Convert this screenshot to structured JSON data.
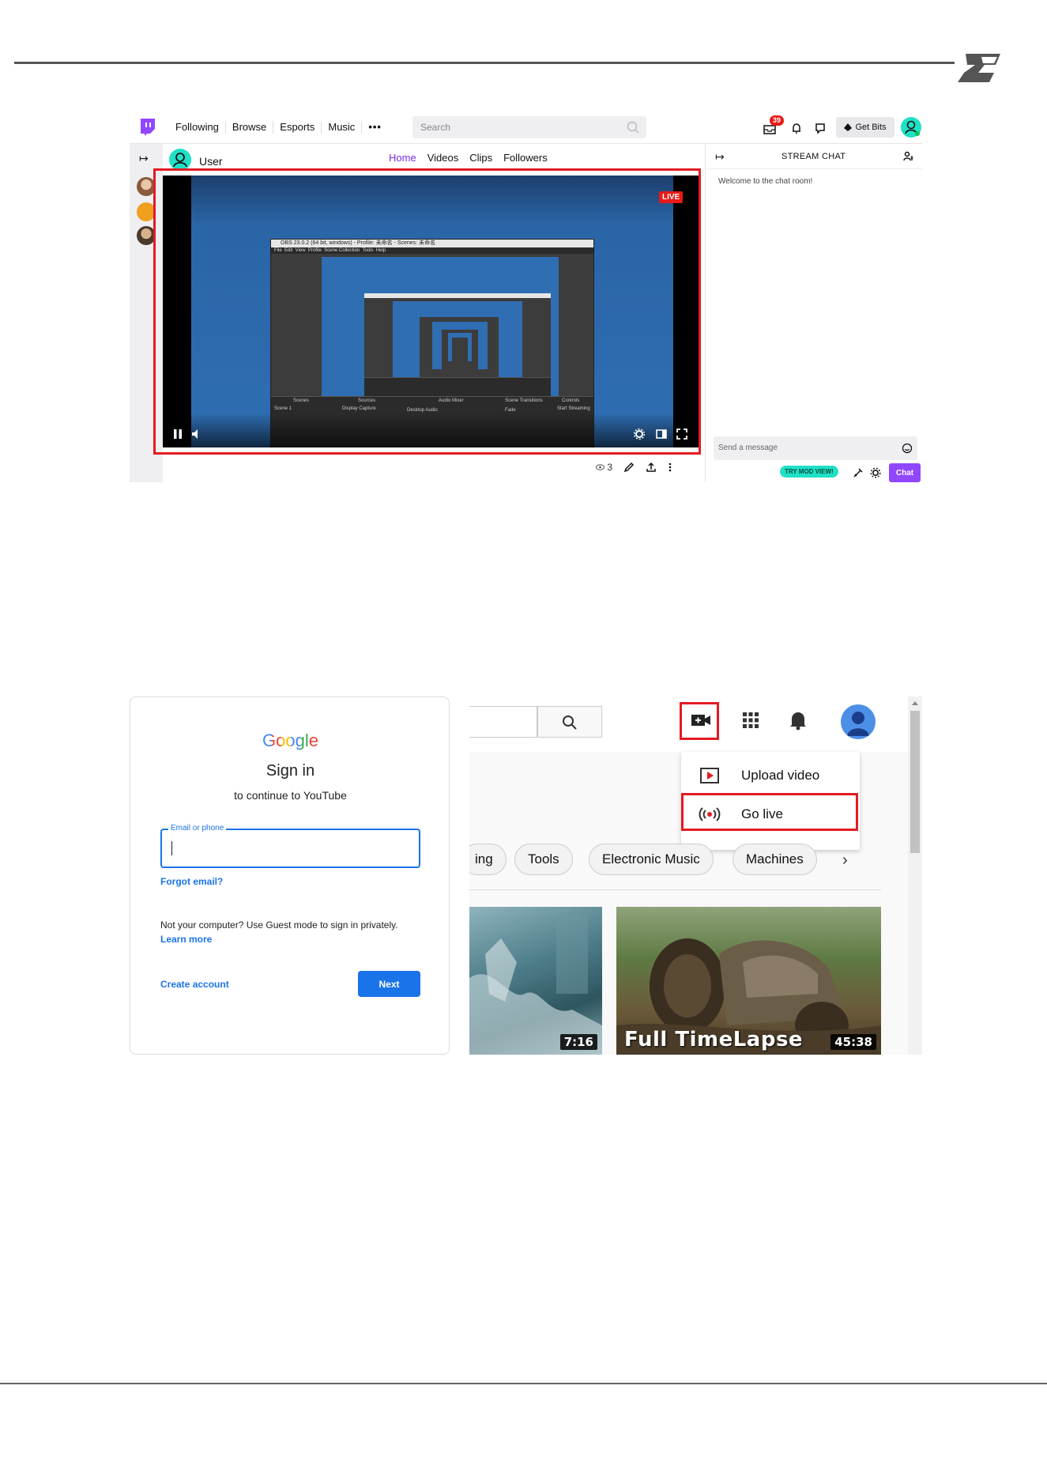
{
  "twitch": {
    "nav": [
      "Following",
      "Browse",
      "Esports",
      "Music",
      "•••"
    ],
    "search_placeholder": "Search",
    "notification_count": "39",
    "get_bits_label": "Get Bits",
    "channel_name": "User",
    "tabs": [
      "Home",
      "Videos",
      "Clips",
      "Followers"
    ],
    "live_badge": "LIVE",
    "viewer_count": "3",
    "chat_title": "STREAM CHAT",
    "chat_welcome": "Welcome to the chat room!",
    "chat_placeholder": "Send a message",
    "mod_view_label": "TRY MOD VIEW!",
    "chat_button": "Chat",
    "obs_title": "OBS 23.0.2 (64 bit, windows) - Profile: 未命名 - Scenes: 未命名",
    "obs_menu": "File  Edit  View  Profile  Scene Collection  Tools  Help",
    "obs_docks": [
      "Scenes",
      "Sources",
      "Audio Mixer",
      "Scene Transitions",
      "Controls"
    ],
    "obs_scene": "Scene 1",
    "obs_source": "Display Capture",
    "obs_audio": "Desktop Audio",
    "obs_transition": "Fade",
    "obs_start": "Start Streaming",
    "accent_color": "#9147ff"
  },
  "google": {
    "logo": "Google",
    "title": "Sign in",
    "subtitle": "to continue to YouTube",
    "field_label": "Email or phone",
    "forgot": "Forgot email?",
    "guest_text": "Not your computer? Use Guest mode to sign in privately.",
    "learn_more": "Learn more",
    "create_account": "Create account",
    "next": "Next",
    "accent_color": "#1a73e8"
  },
  "youtube": {
    "menu": [
      "Upload video",
      "Go live"
    ],
    "chips": [
      "ing",
      "Tools",
      "Electronic Music",
      "Machines"
    ],
    "thumbnails": [
      {
        "duration": "7:16",
        "title": ""
      },
      {
        "duration": "45:38",
        "title": "Full TimeLapse"
      }
    ]
  }
}
